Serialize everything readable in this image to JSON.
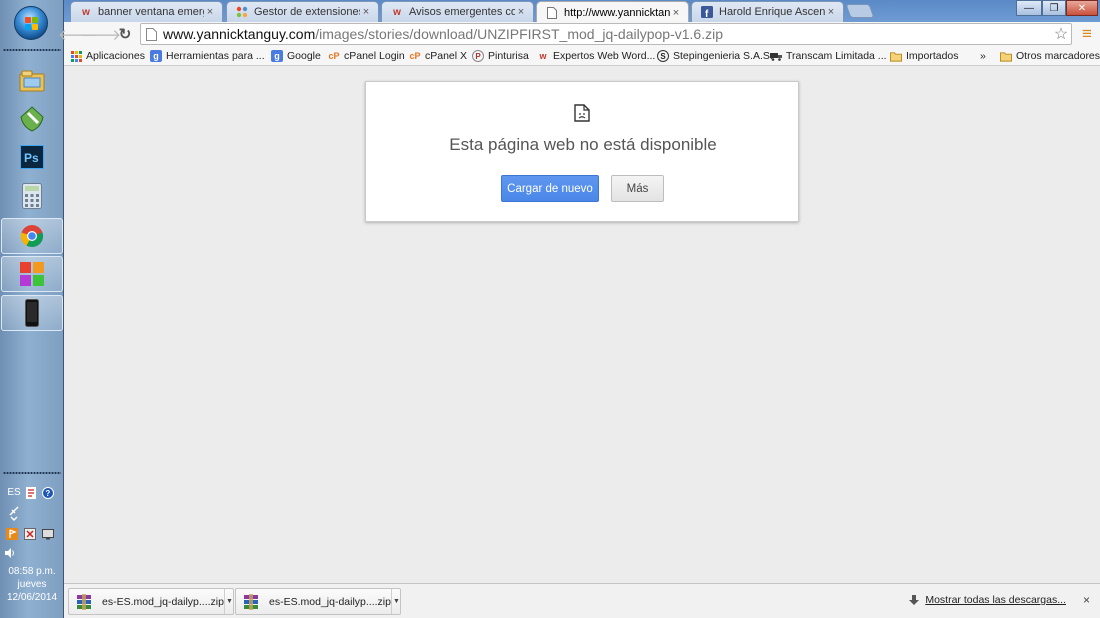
{
  "browser": {
    "tabs": [
      {
        "title": "banner ventana emergent",
        "favicon": "wix-icon",
        "active": false
      },
      {
        "title": "Gestor de extensiones - In",
        "favicon": "joomla-icon",
        "active": false
      },
      {
        "title": "Avisos emergentes con jQ",
        "favicon": "wix-icon",
        "active": false
      },
      {
        "title": "http://www.yannicktangu",
        "favicon": "page-icon",
        "active": true
      },
      {
        "title": "Harold Enrique Ascencio",
        "favicon": "facebook-icon",
        "active": false
      }
    ],
    "tab_close_glyph": "×",
    "window_controls": {
      "minimize": "—",
      "maximize": "❐",
      "close": "✕"
    }
  },
  "toolbar": {
    "back_glyph": "🡐",
    "forward_glyph": "🡒",
    "reload_glyph": "↻",
    "url_host": "www.yannicktanguy.com",
    "url_path": "/images/stories/download/UNZIPFIRST_mod_jq-dailypop-v1.6.zip",
    "star_glyph": "☆",
    "menu_glyph": "≡"
  },
  "bookmarks": {
    "items": [
      {
        "label": "Aplicaciones",
        "icon": "apps-grid-icon"
      },
      {
        "label": "Herramientas para ...",
        "icon": "google-g-icon"
      },
      {
        "label": "Google",
        "icon": "google-g-icon"
      },
      {
        "label": "cPanel Login",
        "icon": "cpanel-icon"
      },
      {
        "label": "cPanel X",
        "icon": "cpanel-icon"
      },
      {
        "label": "Pinturisa",
        "icon": "pinturisa-icon"
      },
      {
        "label": "Expertos Web Word...",
        "icon": "wix-icon"
      },
      {
        "label": "Stepingenieria S.A.S.",
        "icon": "steping-icon"
      },
      {
        "label": "Transcam Limitada ...",
        "icon": "transcam-icon"
      },
      {
        "label": "Importados",
        "icon": "folder-icon"
      }
    ],
    "overflow_glyph": "»",
    "other_bookmarks": "Otros marcadores"
  },
  "error_page": {
    "title": "Esta página web no está disponible",
    "reload_button": "Cargar de nuevo",
    "more_button": "Más"
  },
  "downloads": {
    "items": [
      {
        "filename": "es-ES.mod_jq-dailyp....zip",
        "icon": "winrar-icon"
      },
      {
        "filename": "es-ES.mod_jq-dailyp....zip",
        "icon": "winrar-icon"
      }
    ],
    "show_all": "Mostrar todas las descargas...",
    "close_glyph": "×"
  },
  "system_tray": {
    "language": "ES",
    "time": "08:58 p.m.",
    "day": "jueves",
    "date": "12/06/2014"
  },
  "colors": {
    "taskbar": "#8fb0d0",
    "tabstrip": "#6f9bd3",
    "reload_button": "#4a87e8",
    "content_bg": "#ececec"
  }
}
